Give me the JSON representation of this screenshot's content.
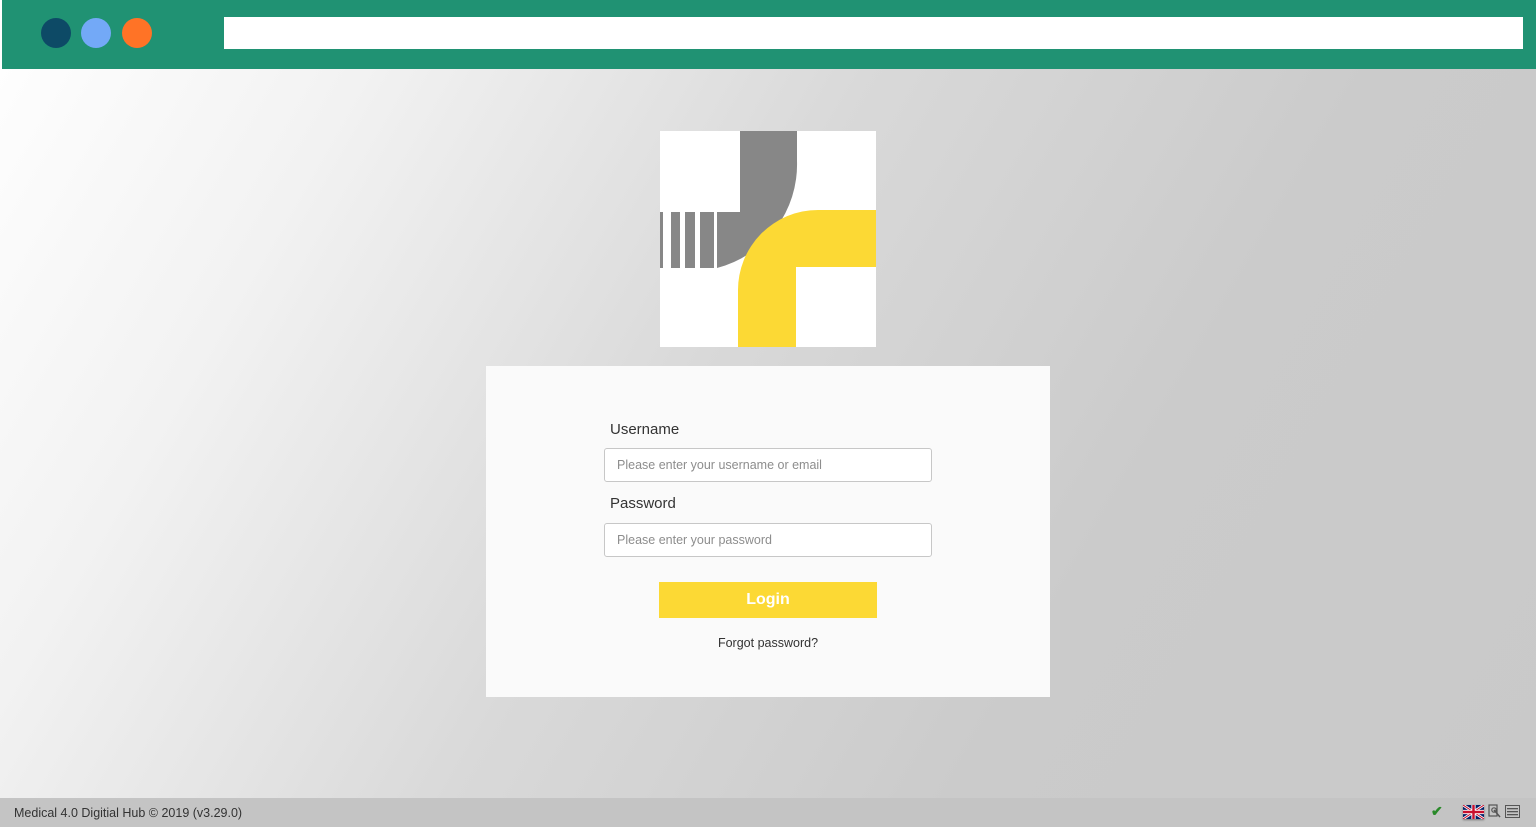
{
  "window": {
    "dots": [
      "#0d4a66",
      "#73a9f7",
      "#ff7326"
    ],
    "address_value": ""
  },
  "colors": {
    "header": "#209273",
    "accent": "#fcd934",
    "logo_gray": "#878787"
  },
  "login": {
    "username_label": "Username",
    "username_placeholder": "Please enter your username or email",
    "password_label": "Password",
    "password_placeholder": "Please enter your password",
    "login_button": "Login",
    "forgot_link": "Forgot password?"
  },
  "footer": {
    "text": "Medical 4.0 Digitial Hub © 2019 (v3.29.0)",
    "icons": [
      "check-icon",
      "uk-flag-icon",
      "document-tool-icon",
      "list-icon"
    ]
  }
}
